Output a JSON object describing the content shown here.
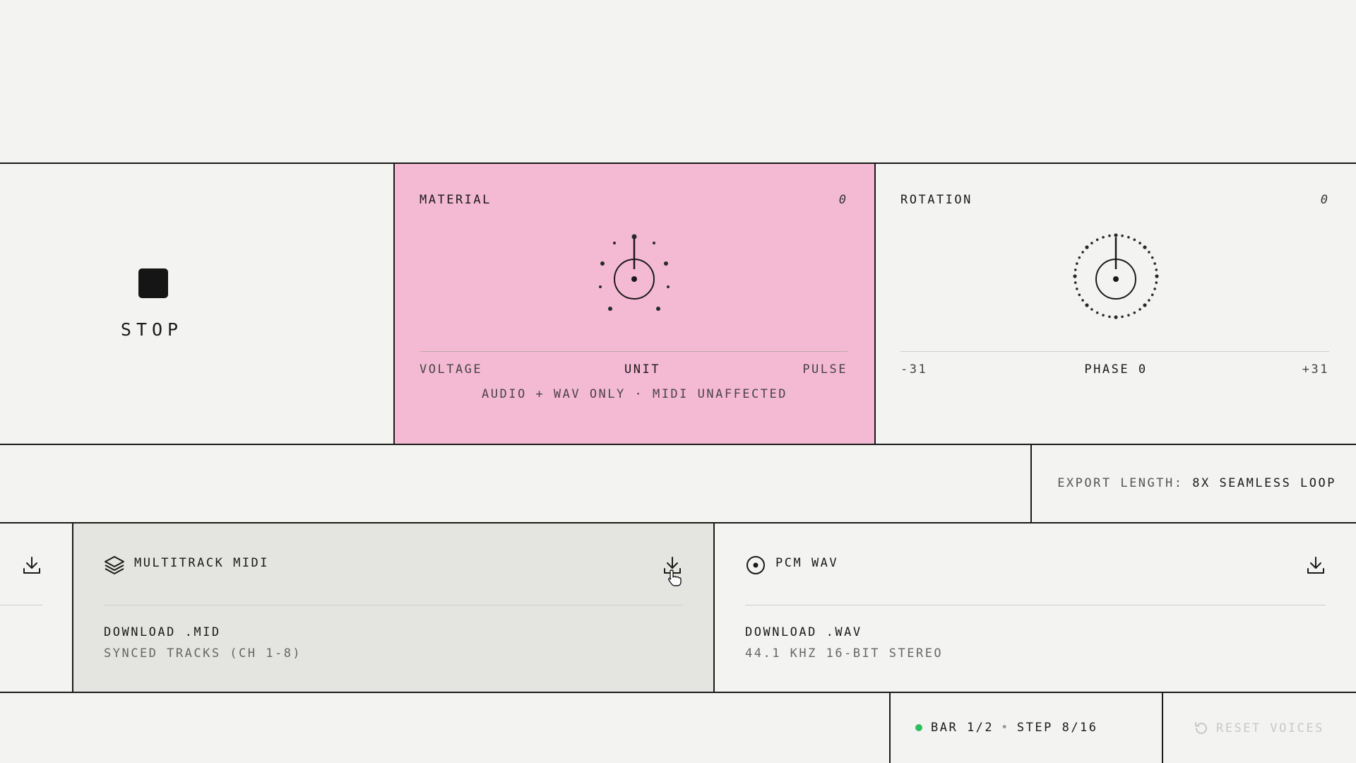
{
  "transport": {
    "stop_label": "STOP"
  },
  "material": {
    "title": "MATERIAL",
    "value": "0",
    "left_tick": "VOLTAGE",
    "mid_tick": "UNIT",
    "right_tick": "PULSE",
    "note": "AUDIO + WAV ONLY · MIDI UNAFFECTED",
    "bg_color": "#f5bad3"
  },
  "rotation": {
    "title": "ROTATION",
    "value": "0",
    "left_tick": "-31",
    "mid_tick": "PHASE 0",
    "right_tick": "+31"
  },
  "export": {
    "length_label": "EXPORT LENGTH:",
    "length_value": "8X SEAMLESS LOOP"
  },
  "midi": {
    "title": "MULTITRACK MIDI",
    "line1": "DOWNLOAD .MID",
    "line2": "SYNCED TRACKS (CH 1-8)",
    "icon": "layers-icon"
  },
  "wav": {
    "title": "PCM WAV",
    "line1": "DOWNLOAD .WAV",
    "line2": "44.1 KHZ 16-BIT STEREO",
    "icon": "disc-icon"
  },
  "status": {
    "bar": "BAR 1/2",
    "separator": "•",
    "step": "STEP 8/16",
    "led_color": "#2fbf5a"
  },
  "reset": {
    "label": "RESET VOICES"
  }
}
